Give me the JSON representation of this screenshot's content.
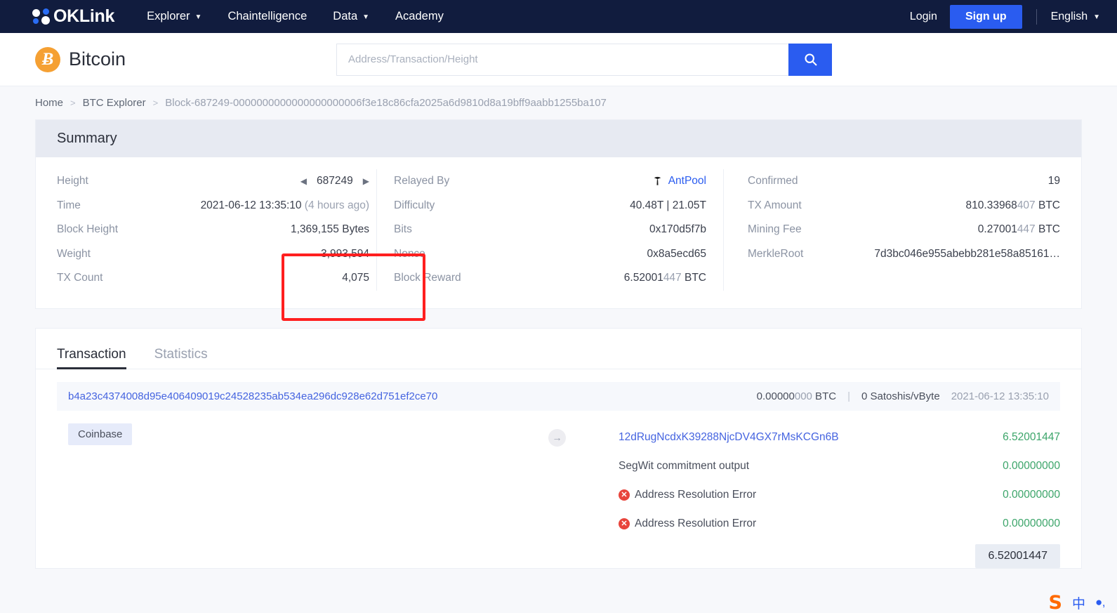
{
  "topnav": {
    "brand": "OKLink",
    "links": [
      {
        "label": "Explorer",
        "caret": "chevron-down-icon"
      },
      {
        "label": "Chaintelligence",
        "caret": ""
      },
      {
        "label": "Data",
        "caret": "chevron-down-icon"
      },
      {
        "label": "Academy",
        "caret": ""
      }
    ],
    "login": "Login",
    "signup": "Sign up",
    "language": "English"
  },
  "subheader": {
    "coin_symbol": "Ƀ",
    "coin_name": "Bitcoin",
    "search_placeholder": "Address/Transaction/Height",
    "search_value": ""
  },
  "breadcrumb": {
    "home": "Home",
    "sep": ">",
    "explorer": "BTC Explorer",
    "current": "Block-687249-0000000000000000000006f3e18c86cfa2025a6d9810d8a19bff9aabb1255ba107"
  },
  "summary": {
    "title": "Summary",
    "col1": [
      {
        "label": "Height",
        "value": "687249",
        "type": "stepper"
      },
      {
        "label": "Time",
        "value": "2021-06-12 13:35:10 ",
        "value_dim": "(4 hours ago)"
      },
      {
        "label": "Block Height",
        "value": "1,369,155 Bytes"
      },
      {
        "label": "Weight",
        "value": "3,993,594"
      },
      {
        "label": "TX Count",
        "value": "4,075"
      }
    ],
    "col2": [
      {
        "label": "Relayed By",
        "value": "AntPool",
        "type": "pool-link"
      },
      {
        "label": "Difficulty",
        "value": "40.48T | 21.05T"
      },
      {
        "label": "Bits",
        "value": "0x170d5f7b"
      },
      {
        "label": "Nonce",
        "value": "0x8a5ecd65"
      },
      {
        "label": "Block Reward",
        "value": "6.52001",
        "value_dim": "447",
        "suffix": " BTC"
      }
    ],
    "col3": [
      {
        "label": "Confirmed",
        "value": "19"
      },
      {
        "label": "TX Amount",
        "value": "810.33968",
        "value_dim": "407",
        "suffix": " BTC"
      },
      {
        "label": "Mining Fee",
        "value": "0.27001",
        "value_dim": "447",
        "suffix": " BTC"
      },
      {
        "label": "MerkleRoot",
        "value": "7d3bc046e955abebb281e58a85161…"
      }
    ],
    "prev_arrow": "◀",
    "next_arrow": "▶"
  },
  "annotation": {
    "color": "#ff1f1f"
  },
  "transactions": {
    "tabs": [
      {
        "label": "Transaction",
        "active": true
      },
      {
        "label": "Statistics",
        "active": false
      }
    ],
    "tx": {
      "hash": "b4a23c4374008d95e406409019c24528235ab534ea296dc928e62d751ef2ce70",
      "fee_main": "0.00000",
      "fee_dim": "000",
      "fee_unit": " BTC",
      "separator": "|",
      "feerate": "0 Satoshis/vByte",
      "time": "2021-06-12 13:35:10",
      "input_tag": "Coinbase",
      "arrow": "→",
      "outputs": [
        {
          "name": "12dRugNcdxK39288NjcDV4GX7rMsKCGn6B",
          "amount": "6.52001447",
          "link": true,
          "error": false
        },
        {
          "name": "SegWit commitment output",
          "amount": "0.00000000",
          "link": false,
          "error": false
        },
        {
          "name": "Address Resolution Error",
          "amount": "0.00000000",
          "link": false,
          "error": true
        },
        {
          "name": "Address Resolution Error",
          "amount": "0.00000000",
          "link": false,
          "error": true
        }
      ],
      "total": "6.52001447"
    }
  },
  "ime": {
    "logo": "S",
    "mode": "中",
    "dot": "●‚"
  }
}
